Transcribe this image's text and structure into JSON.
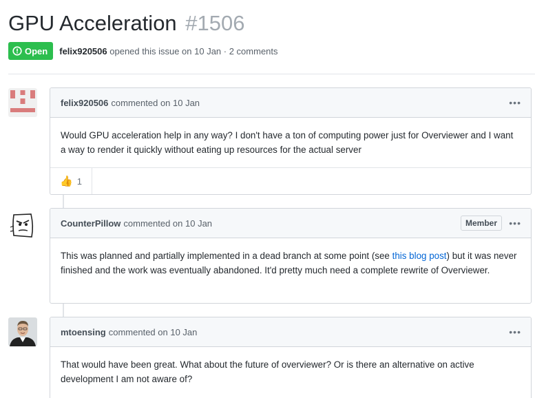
{
  "issue": {
    "title": "GPU Acceleration",
    "number": "#1506",
    "state": "Open",
    "author": "felix920506",
    "opened_text": "opened this issue on 10 Jan · 2 comments"
  },
  "comments": [
    {
      "author": "felix920506",
      "action": "commented on 10 Jan",
      "body": "Would GPU acceleration help in any way? I don't have a ton of computing power just for Overviewer and I want a way to render it quickly without eating up resources for the actual server",
      "reactions": [
        {
          "icon": "thumbs-up-icon",
          "emoji": "👍",
          "count": "1"
        }
      ]
    },
    {
      "author": "CounterPillow",
      "action": "commented on 10 Jan",
      "role": "Member",
      "body_before": "This was planned and partially implemented in a dead branch at some point (see ",
      "link_text": "this blog post",
      "body_after": ") but it was never finished and the work was eventually abandoned. It'd pretty much need a complete rewrite of Overviewer."
    },
    {
      "author": "mtoensing",
      "action": "commented on 10 Jan",
      "body": "That would have been great. What about the future of overviewer? Or is there an alternative on active development I am not aware of?"
    }
  ],
  "colors": {
    "open_badge": "#2cbe4e",
    "link": "#0366d6",
    "identicon": "#d97c7c"
  }
}
